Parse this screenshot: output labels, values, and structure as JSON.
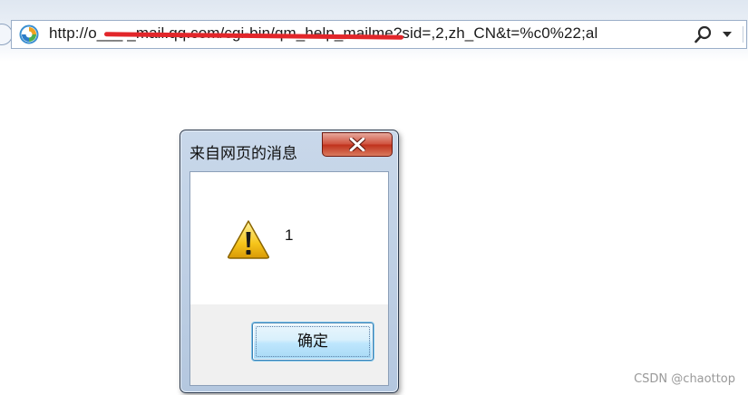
{
  "browser": {
    "address_bar": {
      "url_text": "http://o___ _mail.qq.com/cgi-bin/qm_help_mailme?sid=,2,zh_CN&t=%c0%22;al"
    }
  },
  "dialog": {
    "title": "来自网页的消息",
    "message": "1",
    "ok_label": "确定",
    "close_glyph": "X"
  },
  "watermark": "CSDN @chaottop",
  "colors": {
    "redaction": "#e2262a",
    "close_button": "#c0321c",
    "ok_button_border": "#3c7fb1"
  },
  "icons": {
    "page": "browser-page-icon",
    "search": "search-icon",
    "dropdown": "dropdown-arrow-icon",
    "close": "close-icon",
    "warning": "warning-icon"
  }
}
